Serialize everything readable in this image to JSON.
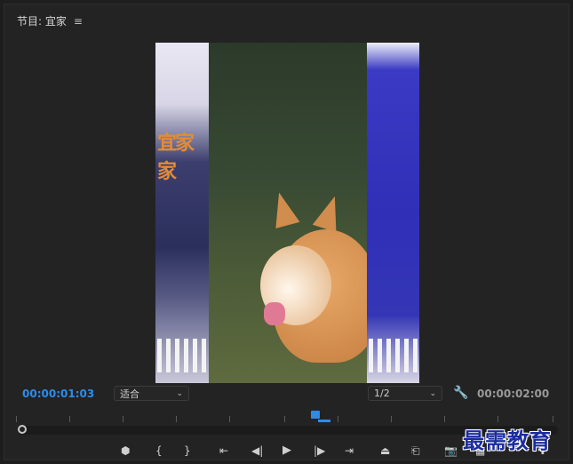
{
  "panel": {
    "title": "节目: 宜家",
    "menu_icon": "hamburger-menu-icon"
  },
  "viewer": {
    "sign_text": "宜家家"
  },
  "timecode": {
    "current": "00:00:01:03",
    "duration": "00:00:02:00"
  },
  "fit_dropdown": {
    "selected": "适合"
  },
  "resolution_dropdown": {
    "selected": "1/2"
  },
  "playhead_progress": 0.55,
  "controls": {
    "add_marker": "add-marker-icon",
    "mark_in": "mark-in-icon",
    "mark_out": "mark-out-icon",
    "go_to_in": "go-to-in-icon",
    "step_back": "step-back-icon",
    "play": "play-icon",
    "step_forward": "step-forward-icon",
    "go_to_out": "go-to-out-icon",
    "lift": "lift-icon",
    "extract": "extract-icon",
    "export_frame": "camera-icon",
    "comparison_view": "comparison-view-icon",
    "add_button": "plus-icon"
  },
  "colors": {
    "accent": "#2d8ceb",
    "panel_bg": "#232323",
    "watermark": "#1b2c9e"
  },
  "watermark": {
    "text": "最需教育"
  }
}
